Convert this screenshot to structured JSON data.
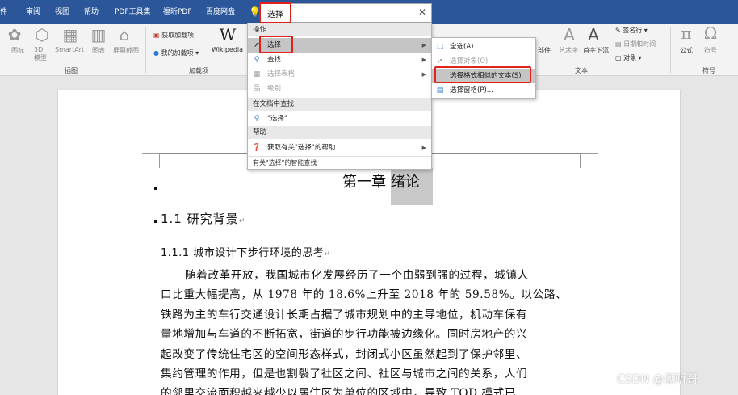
{
  "ribbon_tabs": [
    "件",
    "审阅",
    "视图",
    "帮助",
    "PDF工具集",
    "福昕PDF",
    "百度网盘"
  ],
  "tell_me": {
    "value": "选择"
  },
  "ribbon": {
    "insert_group": {
      "items": [
        "图标",
        "3D\n模型",
        "SmartArt",
        "图表",
        "屏幕截图"
      ],
      "label": "插图"
    },
    "addins_group": {
      "get_addins": "获取加载项",
      "my_addins": "我的加载项",
      "wikipedia": "Wikipedia",
      "label": "加载项"
    },
    "text_group": {
      "header_footer": "部件",
      "wordart": "艺术字",
      "dropcap": "首字下沉",
      "label": "文本"
    },
    "right_group": {
      "signature": "签名行",
      "datetime": "日期和时间",
      "object": "对象"
    },
    "symbols_group": {
      "equation": "公式",
      "symbol": "符号",
      "label": "符号"
    }
  },
  "menu": {
    "section_actions": "操作",
    "items": [
      {
        "icon": "cursor-icon",
        "label": "选择",
        "has_submenu": true,
        "disabled": false
      },
      {
        "icon": "find-icon",
        "label": "查找",
        "has_submenu": true,
        "disabled": false
      },
      {
        "icon": "table-select-icon",
        "label": "选择表格",
        "has_submenu": true,
        "disabled": true
      },
      {
        "icon": "level-icon",
        "label": "级别",
        "has_submenu": false,
        "disabled": true
      }
    ],
    "section_doc": "在文档中查找",
    "doc_item": "\"选择\"",
    "section_help": "帮助",
    "help_item": "获取有关\"选择\"的帮助",
    "footer": "有关\"选择\"的智能查找"
  },
  "submenu": {
    "items": [
      {
        "label": "全选(A)",
        "disabled": false
      },
      {
        "label": "选择对象(O)",
        "disabled": true
      },
      {
        "label": "选择格式相似的文本(S)",
        "disabled": false
      },
      {
        "label": "选择窗格(P)...",
        "disabled": false
      }
    ]
  },
  "document": {
    "chapter_prefix": "第一章",
    "chapter_word": "绪论",
    "section_heading": "1.1 研究背景",
    "subsection_heading": "1.1.1 城市设计下步行环境的思考",
    "para_mark": "↵",
    "paragraph_lines": [
      "随着改革开放，我国城市化发展经历了一个由弱到强的过程，城镇人",
      "口比重大幅提高，从 1978 年的 18.6%上升至 2018 年的 59.58%。以公路、",
      "铁路为主的车行交通设计长期占据了城市规划中的主导地位，机动车保有",
      "量地增加与车道的不断拓宽，街道的步行功能被边缘化。同时房地产的兴",
      "起改变了传统住宅区的空间形态样式，封闭式小区虽然起到了保护邻里、",
      "集约管理的作用，但是也割裂了社区之间、社区与城市之间的关系，人们",
      "的邻里交流面积越来越少以居住区为单位的区域中，导致 TOD 模式已"
    ]
  },
  "watermark": "CSDN @潮听哥"
}
